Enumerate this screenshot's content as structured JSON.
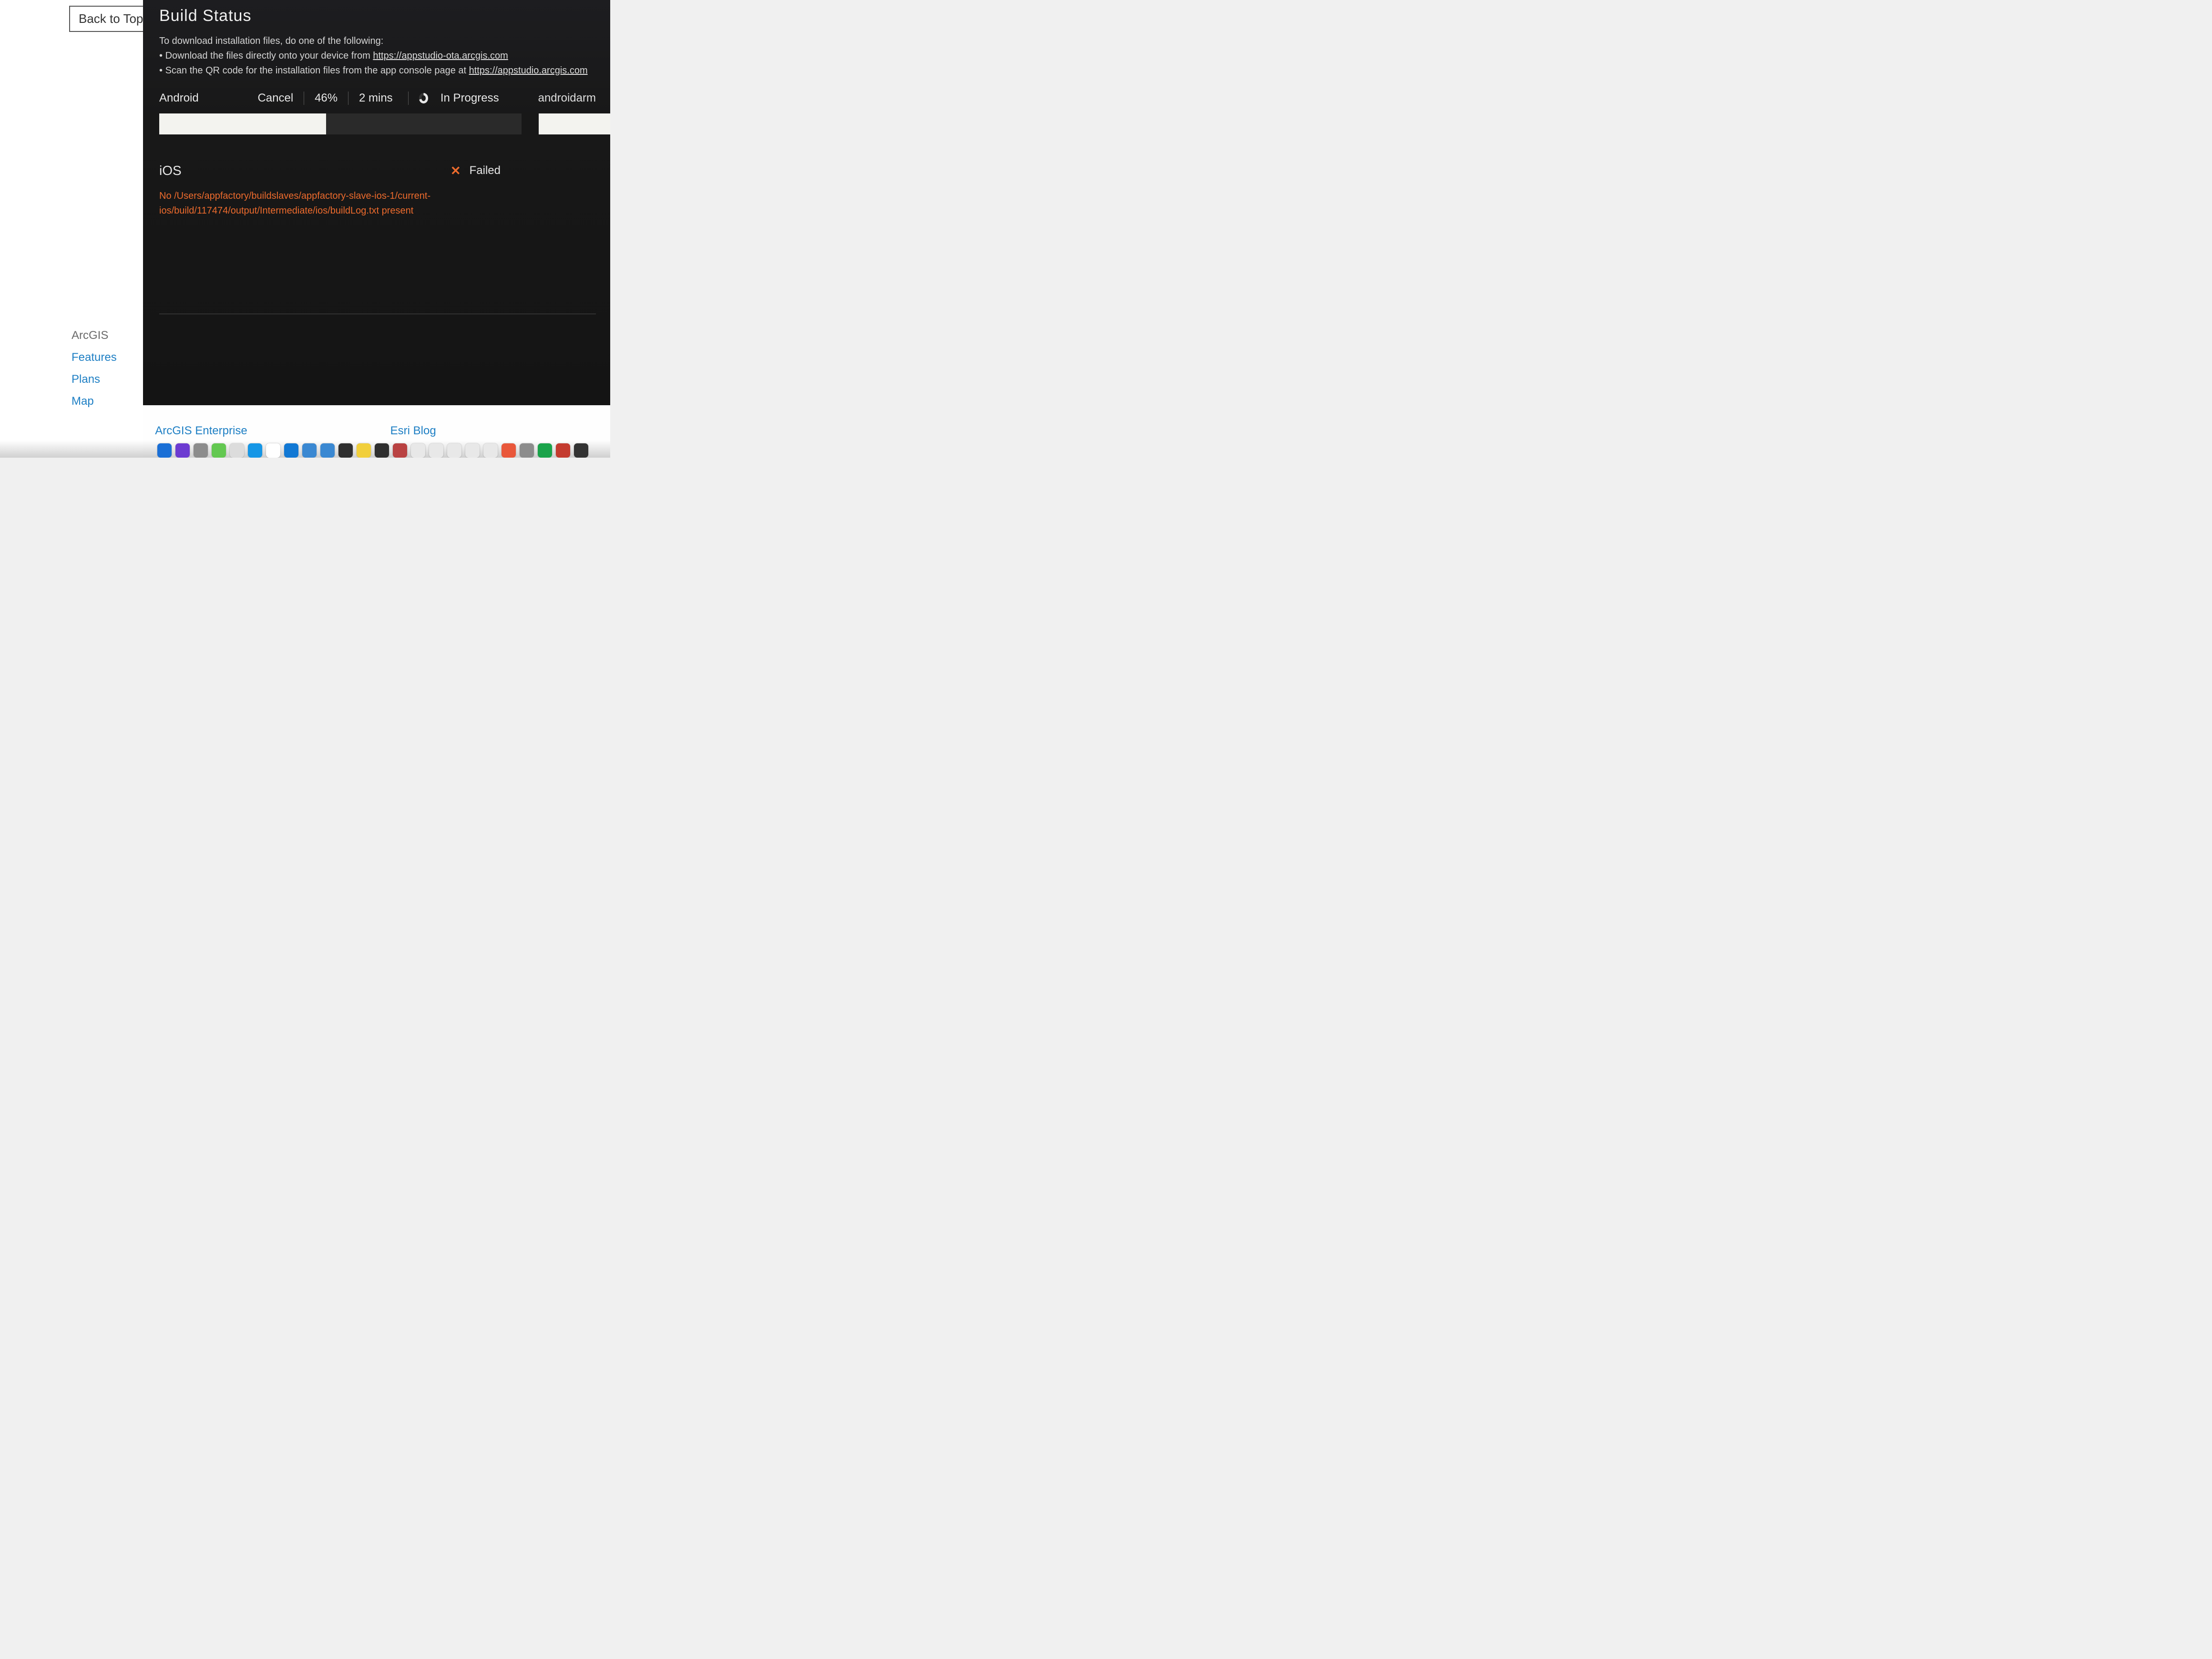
{
  "left": {
    "back_to_top": "Back to Top",
    "heading": "ArcGIS",
    "links": [
      "Features",
      "Plans",
      "Map"
    ]
  },
  "bottom_links": {
    "center": "ArcGIS Enterprise",
    "right": "Esri Blog"
  },
  "modal": {
    "title": "Build Status",
    "instructions_lead": "To download installation files, do one of the following:",
    "bullet1_prefix": "Download the files directly onto your device from ",
    "bullet1_link": "https://appstudio-ota.arcgis.com",
    "bullet2_prefix": "Scan the QR code for the installation files from the app console page at ",
    "bullet2_link": "https://appstudio.arcgis.com",
    "android": {
      "label": "Android",
      "cancel": "Cancel",
      "percent": "46%",
      "eta": "2 mins",
      "status": "In Progress",
      "target": "androidarm",
      "progress_percent": 46
    },
    "ios": {
      "label": "iOS",
      "status": "Failed",
      "error": "No /Users/appfactory/buildslaves/appfactory-slave-ios-1/current-ios/build/117474/output/Intermediate/ios/buildLog.txt present"
    }
  },
  "dock_colors": [
    "#1a6fd6",
    "#6c3bd1",
    "#8c8c8c",
    "#63c851",
    "#dcdcdc",
    "#1596e6",
    "#ffffff",
    "#1178d4",
    "#3a88d2",
    "#3a88d2",
    "#2f2f2f",
    "#f1cf3b",
    "#2f2f2f",
    "#b94242",
    "#e8e8e8",
    "#e8e8e8",
    "#e8e8e8",
    "#e8e8e8",
    "#e8e8e8",
    "#e9573a",
    "#8c8c8c",
    "#1aa34a",
    "#c43b2f",
    "#333333"
  ]
}
